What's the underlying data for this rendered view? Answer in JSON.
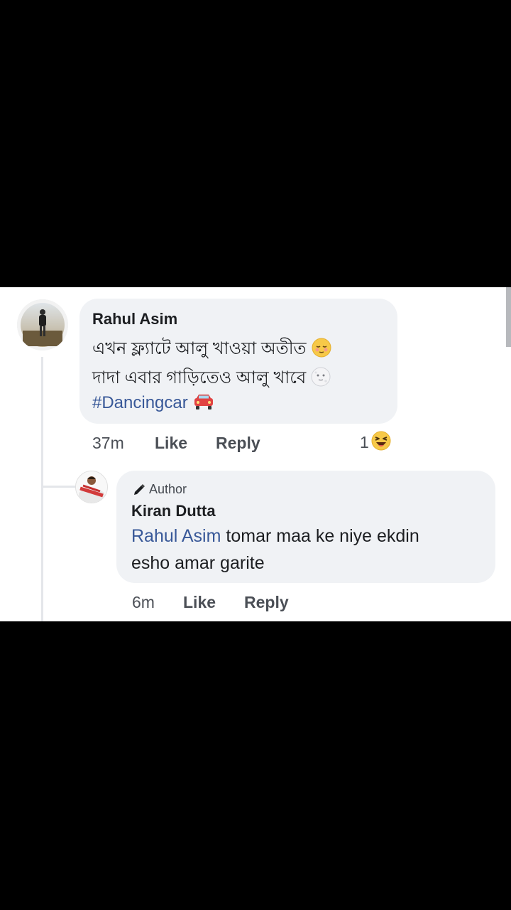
{
  "comment": {
    "author": "Rahul Asim",
    "lines": [
      "এখন ফ্ল্যাটে আলু খাওয়া অতীত",
      "দাদা এবার গাড়িতেও আলু খাবে"
    ],
    "hashtag": "#Dancingcar",
    "time": "37m",
    "like_label": "Like",
    "reply_label": "Reply",
    "reaction_count": "1",
    "emojis": [
      "relieved-face-icon",
      "moon-face-icon",
      "car-icon",
      "laughing-face-icon"
    ]
  },
  "reply": {
    "badge": "Author",
    "author": "Kiran Dutta",
    "mention": "Rahul Asim",
    "text_line1": " tomar maa ke niye ekdin",
    "text_line2": "esho amar garite",
    "time": "6m",
    "like_label": "Like",
    "reply_label": "Reply"
  },
  "colors": {
    "link": "#385898",
    "bubble": "#f0f2f5",
    "text": "#1c1e21",
    "meta": "#4b4f56"
  }
}
